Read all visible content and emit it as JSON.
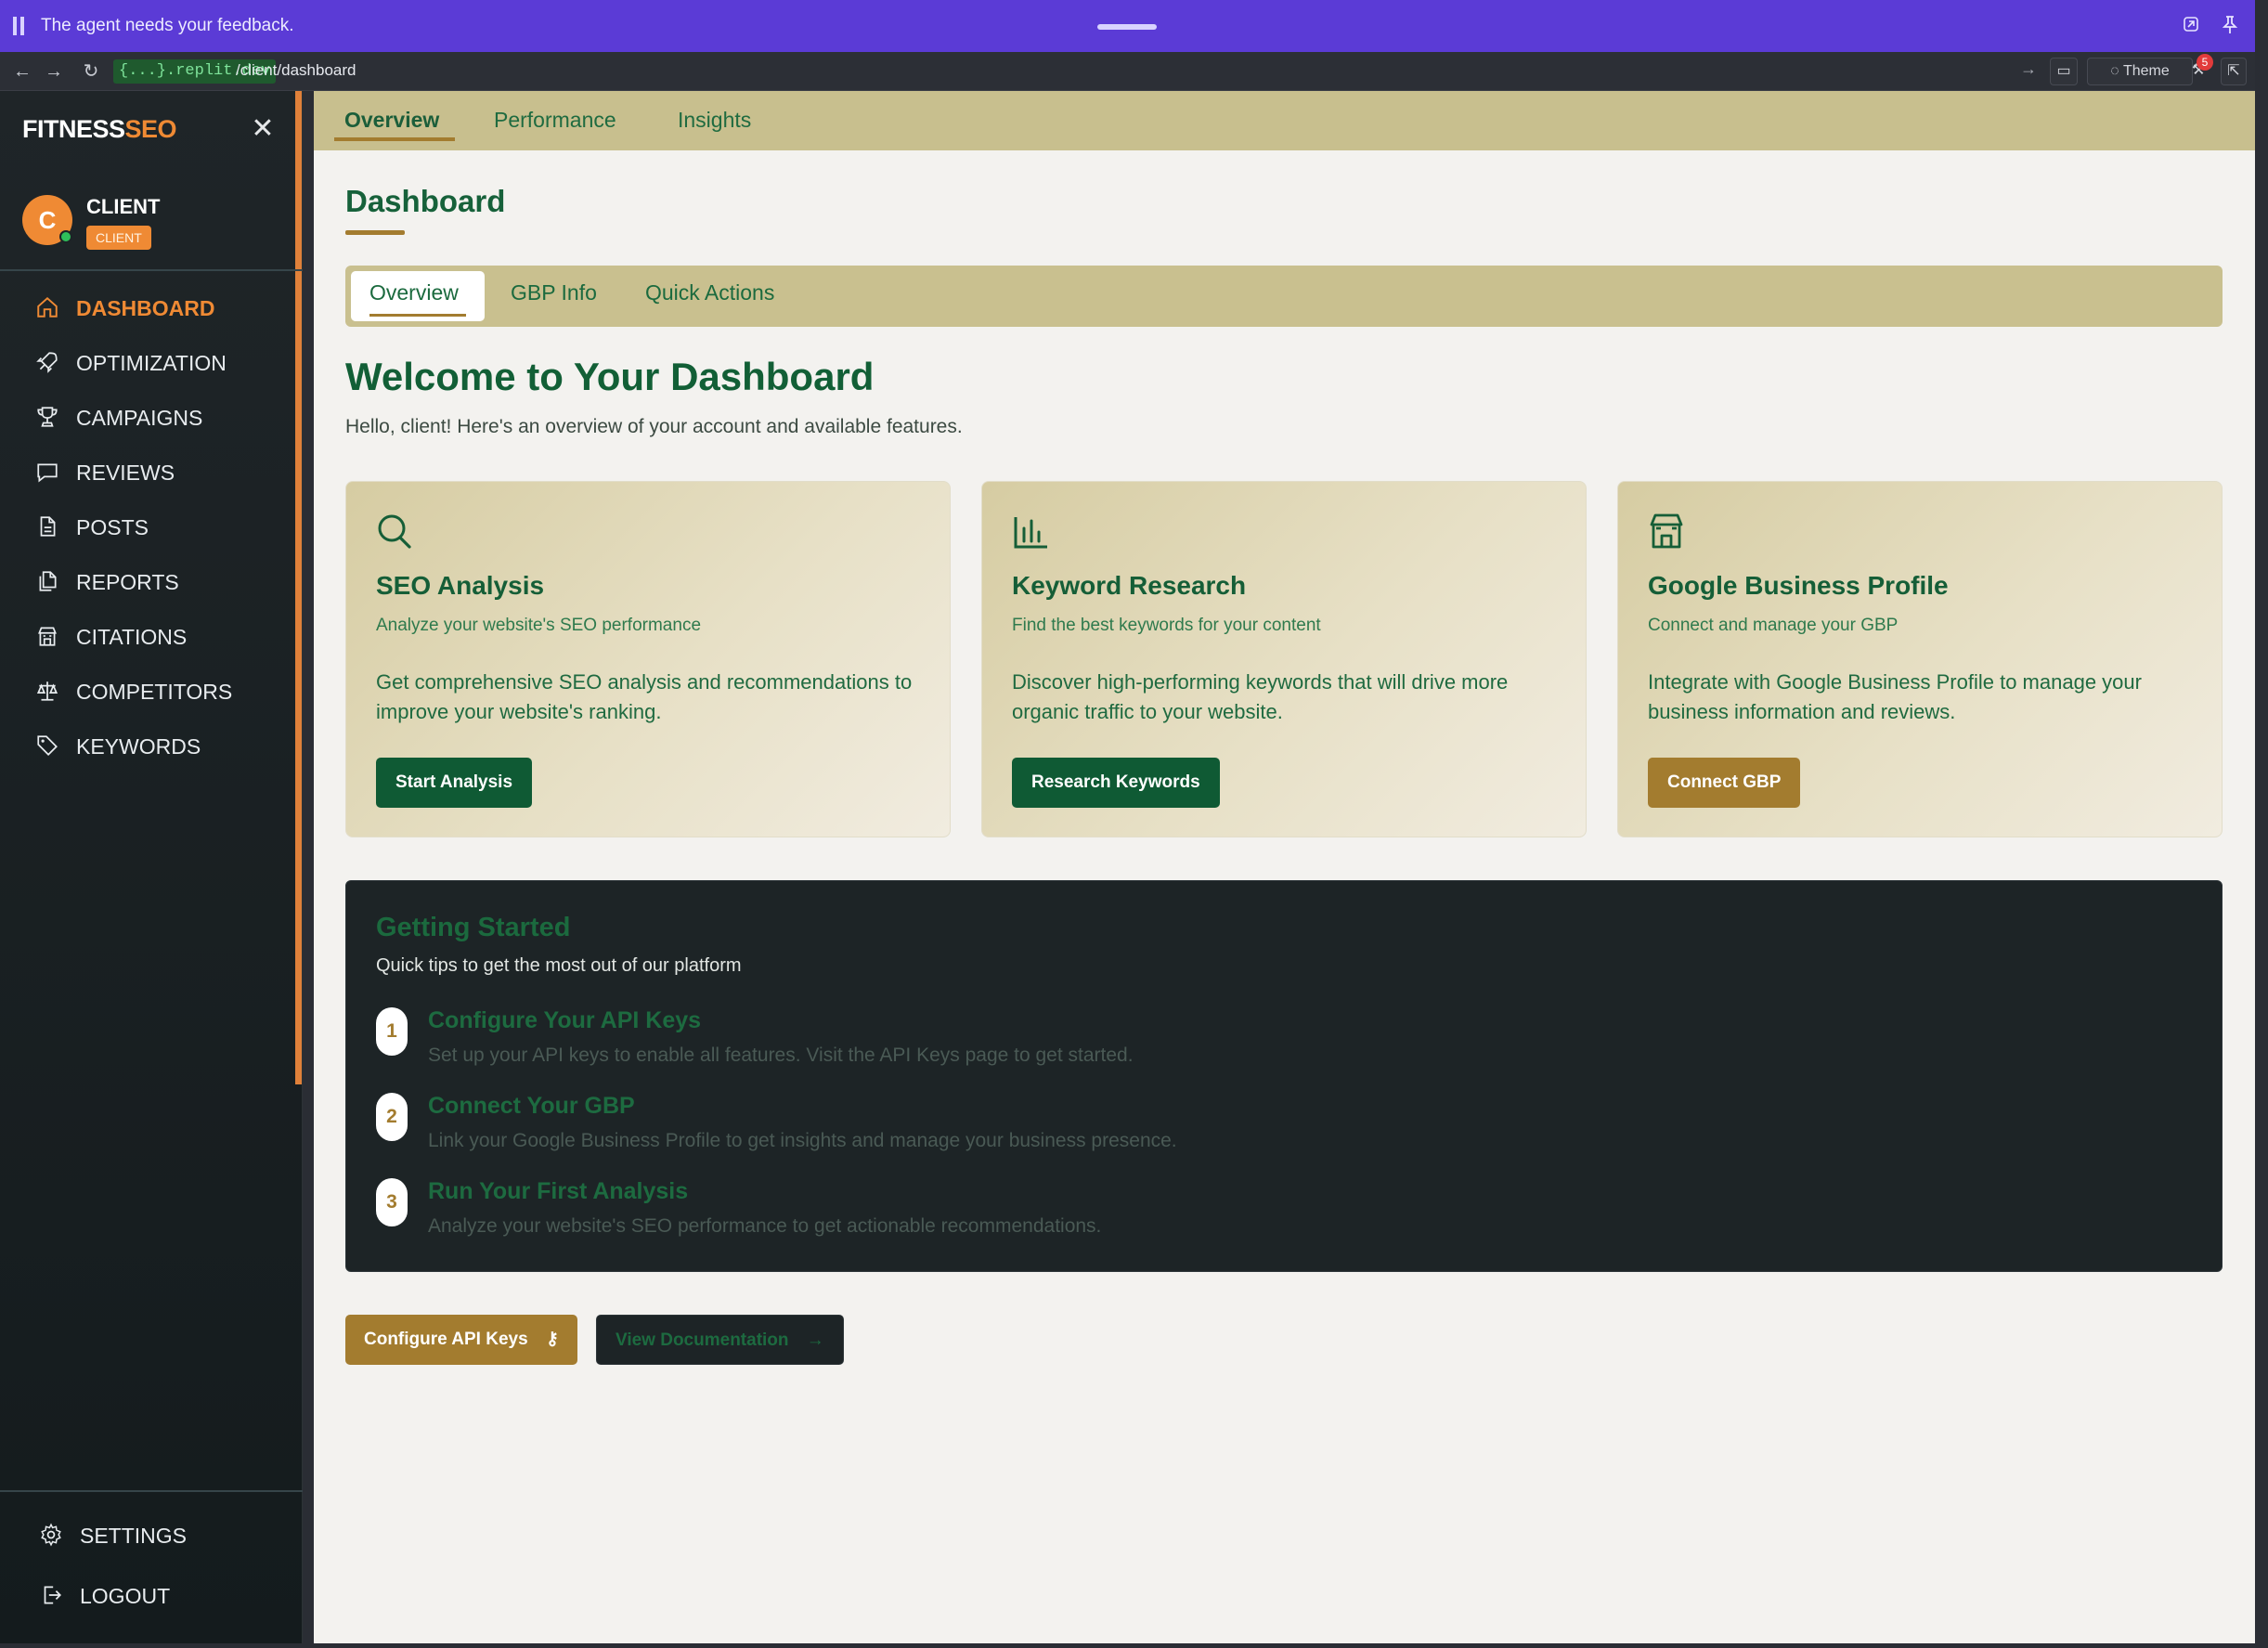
{
  "banner": {
    "message": "The agent needs your feedback."
  },
  "browser": {
    "url_host": "{...}.replit.dev",
    "url_path": "/client/dashboard",
    "theme_label": "Theme",
    "notification_count": "5"
  },
  "sidebar": {
    "logo_part1": "FITNESS",
    "logo_part2": "SEO",
    "avatar_letter": "C",
    "user_name": "CLIENT",
    "user_role": "CLIENT",
    "items": [
      {
        "label": "DASHBOARD",
        "icon": "home-icon"
      },
      {
        "label": "OPTIMIZATION",
        "icon": "rocket-icon"
      },
      {
        "label": "CAMPAIGNS",
        "icon": "trophy-icon"
      },
      {
        "label": "REVIEWS",
        "icon": "message-icon"
      },
      {
        "label": "POSTS",
        "icon": "document-icon"
      },
      {
        "label": "REPORTS",
        "icon": "files-icon"
      },
      {
        "label": "CITATIONS",
        "icon": "building-icon"
      },
      {
        "label": "COMPETITORS",
        "icon": "scale-icon"
      },
      {
        "label": "KEYWORDS",
        "icon": "tag-icon"
      }
    ],
    "settings_label": "SETTINGS",
    "logout_label": "LOGOUT"
  },
  "topTabs": [
    "Overview",
    "Performance",
    "Insights"
  ],
  "page": {
    "title": "Dashboard",
    "subTabs": [
      "Overview",
      "GBP Info",
      "Quick Actions"
    ],
    "welcome": "Welcome to Your Dashboard",
    "hello": "Hello, client! Here's an overview of your account and available features."
  },
  "cards": [
    {
      "icon": "search-icon",
      "title": "SEO Analysis",
      "subtitle": "Analyze your website's SEO performance",
      "description": "Get comprehensive SEO analysis and recommendations to improve your website's ranking.",
      "button": "Start Analysis",
      "button_color": "#0f5a34"
    },
    {
      "icon": "bar-chart-icon",
      "title": "Keyword Research",
      "subtitle": "Find the best keywords for your content",
      "description": "Discover high-performing keywords that will drive more organic traffic to your website.",
      "button": "Research Keywords",
      "button_color": "#0f5a34"
    },
    {
      "icon": "store-icon",
      "title": "Google Business Profile",
      "subtitle": "Connect and manage your GBP",
      "description": "Integrate with Google Business Profile to manage your business information and reviews.",
      "button": "Connect GBP",
      "button_color": "#a37c2f"
    }
  ],
  "gettingStarted": {
    "title": "Getting Started",
    "subtitle": "Quick tips to get the most out of our platform",
    "steps": [
      {
        "num": "1",
        "title": "Configure Your API Keys",
        "desc": "Set up your API keys to enable all features. Visit the API Keys page to get started."
      },
      {
        "num": "2",
        "title": "Connect Your GBP",
        "desc": "Link your Google Business Profile to get insights and manage your business presence."
      },
      {
        "num": "3",
        "title": "Run Your First Analysis",
        "desc": "Analyze your website's SEO performance to get actionable recommendations."
      }
    ]
  },
  "bottomButtons": {
    "configure": "Configure API Keys",
    "docs": "View Documentation"
  },
  "colors": {
    "brand_green": "#125f36",
    "brand_gold": "#a37c2f",
    "accent_orange": "#ef8a34",
    "banner_purple": "#5b3bd6"
  }
}
